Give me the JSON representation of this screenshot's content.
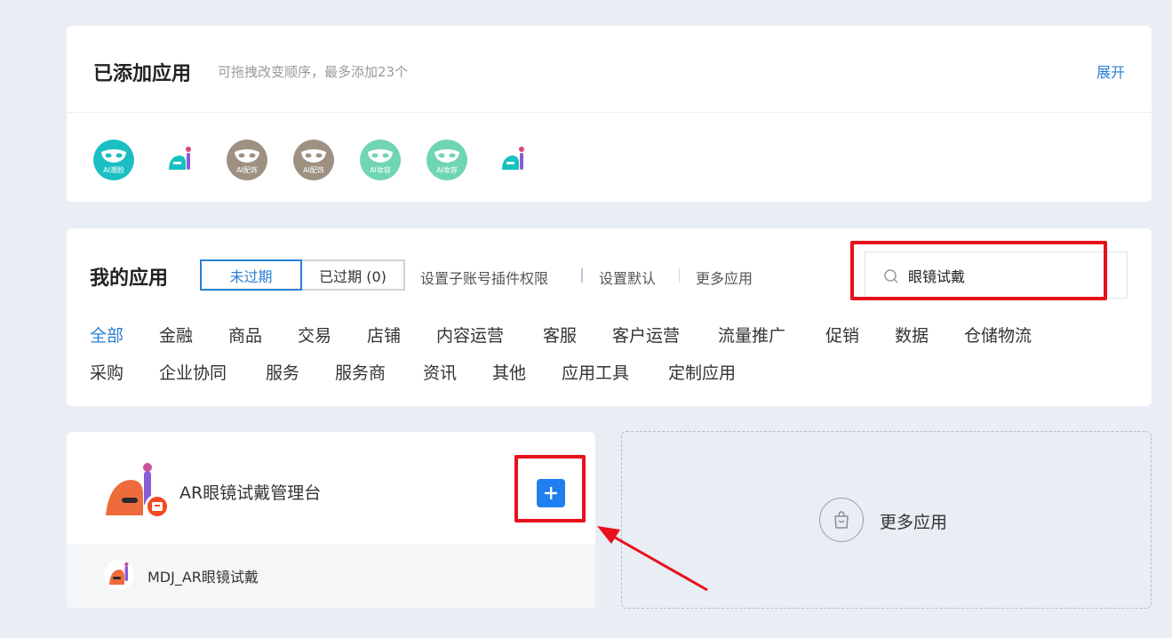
{
  "added_section": {
    "title": "已添加应用",
    "hint": "可拖拽改变顺序，最多添加23个",
    "expand_label": "展开",
    "icons": [
      {
        "name": "ai-mask-icon",
        "text": "AI潮脸",
        "color": "#1bbfc3"
      },
      {
        "name": "ar-glasses-app-icon",
        "color": "#16c2c1"
      },
      {
        "name": "ai-mask-icon",
        "text": "AI配饰",
        "color": "#9e9182"
      },
      {
        "name": "ai-mask-icon",
        "text": "AI配饰",
        "color": "#9e9182"
      },
      {
        "name": "ai-mask-icon",
        "text": "AI妆容",
        "color": "#6fd5b2"
      },
      {
        "name": "ai-mask-icon",
        "text": "AI妆容",
        "color": "#6fd5b2"
      },
      {
        "name": "ar-glasses-app-icon",
        "color": "#16c2c1"
      }
    ]
  },
  "my_apps": {
    "title": "我的应用",
    "tab_active": "未过期",
    "tab_expired": "已过期 (0)",
    "link_permissions": "设置子账号插件权限",
    "link_default": "设置默认",
    "link_more": "更多应用",
    "search_value": "眼镜试戴",
    "categories_row1": [
      "全部",
      "金融",
      "商品",
      "交易",
      "店铺",
      "内容运营",
      "客服",
      "客户运营",
      "流量推广",
      "促销",
      "数据",
      "仓储物流"
    ],
    "categories_row2": [
      "采购",
      "企业协同",
      "服务",
      "服务商",
      "资讯",
      "其他",
      "应用工具",
      "定制应用"
    ]
  },
  "app_card": {
    "name": "AR眼镜试戴管理台",
    "sub_name": "MDJ_AR眼镜试戴"
  },
  "more_card": {
    "label": "更多应用"
  },
  "colors": {
    "accent": "#2a7fd4",
    "add_button": "#1f7ef0",
    "highlight_red": "#e8101c",
    "page_bg": "#e9edf4"
  }
}
